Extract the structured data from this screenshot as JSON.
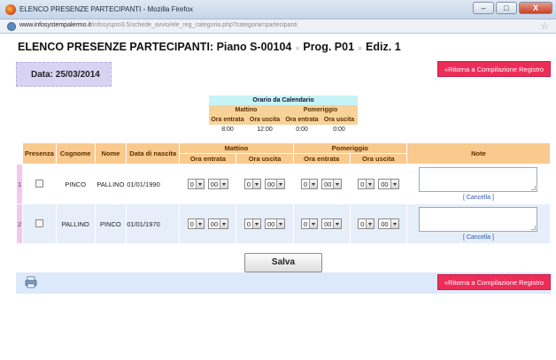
{
  "window": {
    "title": "ELENCO PRESENZE PARTECIPANTI - Mozilla Firefox",
    "url_domain": "www.infosystempalermo.it",
    "url_path": "/infosyspro3.5/schede_avvio/ele_reg_categoria.php?categoria=partecipanti",
    "minimize": "–",
    "maximize": "□",
    "close": "X"
  },
  "heading": {
    "prefix": "ELENCO PRESENZE PARTECIPANTI:",
    "piano": "Piano S-00104",
    "sep": "»",
    "prog": "Prog. P01",
    "ediz": "Ediz. 1"
  },
  "date_label": "Data: 25/03/2014",
  "return_button": "Ritorna a Compilazione Registro",
  "calendar": {
    "title": "Orario da Calendario",
    "morning": "Mattino",
    "afternoon": "Pomeriggio",
    "in": "Ora entrata",
    "out": "Ora uscita",
    "values": [
      "8:00",
      "12:00",
      "0:00",
      "0:00"
    ]
  },
  "table": {
    "headers": {
      "presenza": "Presenza",
      "cognome": "Cognome",
      "nome": "Nome",
      "nascita": "Data di nascita",
      "mattino": "Mattino",
      "pomeriggio": "Pomeriggio",
      "note": "Note",
      "entrata": "Ora entrata",
      "uscita": "Ora uscita"
    },
    "rows": [
      {
        "num": "1",
        "cognome": "PINCO",
        "nome": "PALLINO",
        "nascita": "01/01/1990",
        "h": "0",
        "m": "00"
      },
      {
        "num": "2",
        "cognome": "PALLINO",
        "nome": "PINCO",
        "nascita": "01/01/1970",
        "h": "0",
        "m": "00"
      }
    ],
    "cancel_link": "[ Cancella ]"
  },
  "save_button": "Salva",
  "colors": {
    "accent_button": "#ec2d5a",
    "header_orange": "#f9c98e",
    "date_box": "#d9d3f3",
    "row_alt": "#e6eef9"
  }
}
